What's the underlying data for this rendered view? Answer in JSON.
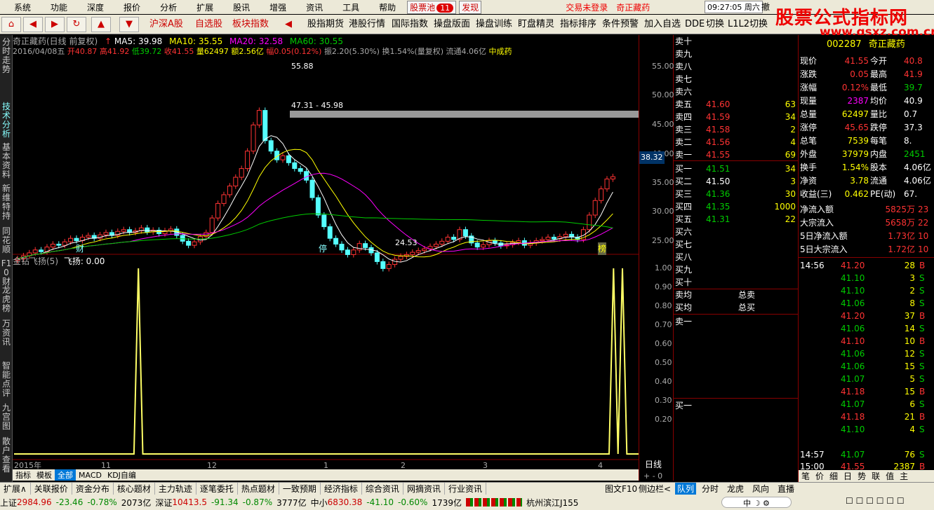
{
  "menu": {
    "items": [
      "系统",
      "功能",
      "深度",
      "报价",
      "分析",
      "扩展",
      "股讯",
      "增强",
      "资讯",
      "工具",
      "帮助"
    ],
    "stock_pool": "股票池",
    "pool_count": "11",
    "discover": "发现",
    "trade_status": "交易未登录",
    "stock_name": "奇正藏药",
    "clock": "09:27:05 周六",
    "cancel": "撤"
  },
  "toolbar": {
    "buttons": [
      "沪深A股",
      "自选股",
      "板块指数"
    ],
    "buttons2": [
      "股指期货",
      "港股行情",
      "国际指数",
      "操盘版面",
      "操盘训练",
      "盯盘精灵",
      "指标排序",
      "条件预警",
      "加入自选",
      "DDE",
      "切换",
      "L1L2切换"
    ]
  },
  "logo": {
    "text": "股票公式指标网",
    "url": "www.gsxz.com.cn"
  },
  "sidebar": [
    "分时走势",
    "技术分析",
    "基本资料",
    "新维特持",
    "同花顺",
    "F10财",
    "龙虎榜",
    "万资讯",
    "智能点评",
    "九宫图",
    "散户查看"
  ],
  "chart": {
    "title": "奇正藏药(日线 前复权)",
    "ma5": "MA5: 39.98",
    "ma10": "MA10: 35.55",
    "ma20": "MA20: 32.58",
    "ma60": "MA60: 30.55",
    "info_date": "2016/04/08五",
    "info_open": "开40.87",
    "info_high": "高41.92",
    "info_low": "低39.72",
    "info_close": "收41.55",
    "info_vol": "量62497",
    "info_amt": "额2.56亿",
    "info_chg": "幅0.05(0.12%)",
    "info_amp": "振2.20(5.30%)",
    "info_turn": "换1.54%(量复权)",
    "info_float": "流通4.06亿",
    "info_tag": "中成药",
    "high_label": "55.88",
    "low_label": "24.53",
    "gap_label": "47.31 - 45.98",
    "marks": [
      "财",
      "停",
      "榜"
    ],
    "ind_title": "金钻飞扬(5)",
    "ind_val": "飞扬: 0.00",
    "yticks": [
      "55.00",
      "50.00",
      "45.00",
      "40.00",
      "35.00",
      "30.00",
      "25.00"
    ],
    "price_box": "38.32",
    "ind_yticks": [
      "1.00",
      "0.90",
      "0.80",
      "0.70",
      "0.60",
      "0.50",
      "0.40",
      "0.30",
      "0.20"
    ],
    "xlabels": [
      "2015年",
      "11",
      "12",
      "1",
      "2",
      "3",
      "4"
    ],
    "period": "日线",
    "tabs": [
      "指标",
      "模板",
      "全部",
      "MACD",
      "KDJ自编"
    ]
  },
  "chart_data": {
    "type": "line",
    "series": [
      {
        "name": "飞扬",
        "values": [
          0,
          0,
          0,
          0,
          0,
          0,
          0,
          0,
          0,
          0,
          0,
          0,
          0,
          0,
          0,
          0,
          0,
          0,
          0,
          0,
          0,
          0,
          0,
          0,
          0,
          0,
          0,
          0,
          1,
          0,
          0,
          0,
          0,
          0,
          0,
          0,
          0,
          0,
          0,
          0,
          0,
          0,
          0,
          0,
          0,
          0,
          0,
          0,
          0,
          0,
          0,
          0,
          0,
          0,
          0,
          0,
          0,
          0,
          0,
          0,
          0,
          0,
          0,
          0,
          0,
          0,
          0,
          0,
          0,
          0,
          0,
          0,
          0,
          0,
          0,
          0,
          0,
          0,
          0,
          0,
          0,
          0,
          0,
          0,
          0,
          0,
          0,
          0,
          0,
          0,
          0,
          0,
          0,
          0,
          0,
          0,
          0,
          0,
          0,
          0,
          0,
          0,
          0,
          0,
          0,
          0,
          0,
          0,
          0,
          0,
          0,
          0,
          0,
          0,
          0,
          0,
          0,
          0,
          0,
          0,
          0,
          0,
          0,
          0,
          0,
          0,
          0,
          0,
          0,
          0,
          0,
          0,
          0,
          0,
          0,
          1,
          0,
          1,
          0,
          0,
          0,
          0
        ]
      }
    ],
    "ylim": [
      0,
      1
    ]
  },
  "quote": {
    "sells": [
      {
        "l": "卖十",
        "p": "",
        "v": ""
      },
      {
        "l": "卖九",
        "p": "",
        "v": ""
      },
      {
        "l": "卖八",
        "p": "",
        "v": ""
      },
      {
        "l": "卖七",
        "p": "",
        "v": ""
      },
      {
        "l": "卖六",
        "p": "",
        "v": ""
      },
      {
        "l": "卖五",
        "p": "41.60",
        "v": "63"
      },
      {
        "l": "卖四",
        "p": "41.59",
        "v": "34"
      },
      {
        "l": "卖三",
        "p": "41.58",
        "v": "2"
      },
      {
        "l": "卖二",
        "p": "41.56",
        "v": "4"
      },
      {
        "l": "卖一",
        "p": "41.55",
        "v": "69"
      }
    ],
    "buys": [
      {
        "l": "买一",
        "p": "41.51",
        "v": "34"
      },
      {
        "l": "买二",
        "p": "41.50",
        "v": "3"
      },
      {
        "l": "买三",
        "p": "41.36",
        "v": "30"
      },
      {
        "l": "买四",
        "p": "41.35",
        "v": "1000"
      },
      {
        "l": "买五",
        "p": "41.31",
        "v": "22"
      },
      {
        "l": "买六",
        "p": "",
        "v": ""
      },
      {
        "l": "买七",
        "p": "",
        "v": ""
      },
      {
        "l": "买八",
        "p": "",
        "v": ""
      },
      {
        "l": "买九",
        "p": "",
        "v": ""
      },
      {
        "l": "买十",
        "p": "",
        "v": ""
      }
    ],
    "sell_avg": "卖均",
    "buy_avg": "买均",
    "total_sell": "总卖",
    "total_buy": "总买",
    "sell1": "卖一",
    "buy1": "买一"
  },
  "right": {
    "code": "002287",
    "name": "奇正藏药",
    "stats": [
      [
        "现价",
        "41.55",
        "今开",
        "40.8"
      ],
      [
        "涨跌",
        "0.05",
        "最高",
        "41.9"
      ],
      [
        "涨幅",
        "0.12%",
        "最低",
        "39.7"
      ],
      [
        "现量",
        "2387",
        "均价",
        "40.9"
      ],
      [
        "总量",
        "62497",
        "量比",
        "0.7"
      ],
      [
        "涨停",
        "45.65",
        "跌停",
        "37.3"
      ],
      [
        "总笔",
        "7539",
        "每笔",
        "8."
      ],
      [
        "外盘",
        "37979",
        "内盘",
        "2451"
      ],
      [
        "换手",
        "1.54%",
        "股本",
        "4.06亿"
      ],
      [
        "净资",
        "3.78",
        "流通",
        "4.06亿"
      ],
      [
        "收益(三)",
        "0.462",
        "PE(动)",
        "67."
      ]
    ],
    "flows": [
      [
        "净流入额",
        "5825万",
        "23"
      ],
      [
        "大宗流入",
        "5658万",
        "22"
      ],
      [
        "5日净流入额",
        "1.73亿",
        "10"
      ],
      [
        "5日大宗流入",
        "1.72亿",
        "10"
      ]
    ],
    "ticks": [
      [
        "14:56",
        "41.20",
        "28",
        "B"
      ],
      [
        "",
        "41.10",
        "3",
        "S"
      ],
      [
        "",
        "41.10",
        "2",
        "S"
      ],
      [
        "",
        "41.06",
        "8",
        "S"
      ],
      [
        "",
        "41.20",
        "37",
        "B"
      ],
      [
        "",
        "41.06",
        "14",
        "S"
      ],
      [
        "",
        "41.10",
        "10",
        "B"
      ],
      [
        "",
        "41.06",
        "12",
        "S"
      ],
      [
        "",
        "41.06",
        "15",
        "S"
      ],
      [
        "",
        "41.07",
        "5",
        "S"
      ],
      [
        "",
        "41.18",
        "15",
        "B"
      ],
      [
        "",
        "41.07",
        "6",
        "S"
      ],
      [
        "",
        "41.18",
        "21",
        "B"
      ],
      [
        "",
        "41.10",
        "4",
        "S"
      ],
      [
        "14:57",
        "41.07",
        "76",
        "S"
      ],
      [
        "15:00",
        "41.55",
        "2387",
        "B"
      ]
    ],
    "tabs": [
      "队列",
      "分时",
      "龙虎",
      "风向",
      "直播",
      "笔",
      "价",
      "细",
      "日",
      "势",
      "联",
      "值",
      "主"
    ]
  },
  "bottom": {
    "tabs": [
      "扩展∧",
      "关联报价",
      "资金分布",
      "核心题材",
      "主力轨迹",
      "逐笔委托",
      "热点题材",
      "一致预期",
      "经济指标",
      "综合资讯",
      "网摘资讯",
      "行业资讯"
    ],
    "f10": "图文F10",
    "side": "侧边栏<"
  },
  "status": {
    "sh": "上证",
    "sh_val": "2984.96",
    "sh_chg": "-23.46",
    "sh_pct": "-0.78%",
    "sh_amt": "2073亿",
    "sz": "深证",
    "sz_val": "10413.5",
    "sz_chg": "-91.34",
    "sz_pct": "-0.87%",
    "sz_amt": "3777亿",
    "zx": "中小",
    "zx_val": "6830.38",
    "zx_chg": "-41.10",
    "zx_pct": "-0.60%",
    "zx_amt": "1739亿",
    "city": "杭州滨江J155"
  }
}
